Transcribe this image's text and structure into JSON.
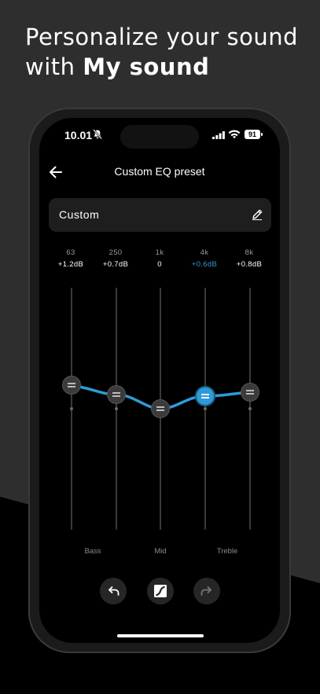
{
  "headline": {
    "line1": "Personalize your sound",
    "line2_prefix": "with ",
    "line2_bold": "My sound"
  },
  "status_bar": {
    "time": "10.01",
    "battery": "91"
  },
  "header": {
    "title": "Custom EQ preset"
  },
  "preset": {
    "name": "Custom"
  },
  "bands": [
    {
      "freq": "63",
      "gain": "+1.2dB",
      "active": false
    },
    {
      "freq": "250",
      "gain": "+0.7dB",
      "active": false
    },
    {
      "freq": "1k",
      "gain": "0",
      "active": false
    },
    {
      "freq": "4k",
      "gain": "+0.6dB",
      "active": true
    },
    {
      "freq": "8k",
      "gain": "+0.8dB",
      "active": false
    }
  ],
  "zones": {
    "low": "Bass",
    "mid": "Mid",
    "high": "Treble"
  },
  "colors": {
    "accent": "#2e9bd8",
    "background": "#000000"
  },
  "icons": {
    "undo": "undo-icon",
    "reset": "sennheiser-logo-icon",
    "redo": "redo-icon"
  }
}
